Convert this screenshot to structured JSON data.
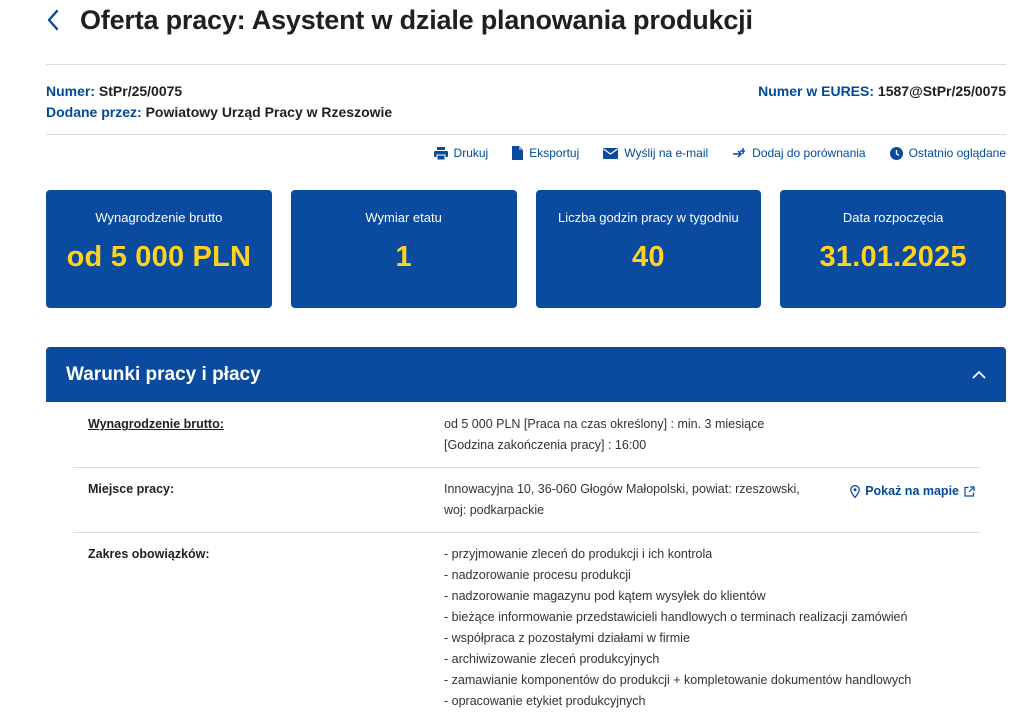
{
  "header": {
    "title": "Oferta pracy: Asystent w dziale planowania produkcji"
  },
  "meta": {
    "number_label": "Numer:",
    "number_value": "StPr/25/0075",
    "added_label": "Dodane przez:",
    "added_value": "Powiatowy Urząd Pracy w Rzeszowie",
    "eures_label": "Numer w EURES:",
    "eures_value": "1587@StPr/25/0075"
  },
  "actions": [
    {
      "label": "Drukuj",
      "icon": "printer-icon"
    },
    {
      "label": "Eksportuj",
      "icon": "document-icon"
    },
    {
      "label": "Wyślij na e-mail",
      "icon": "envelope-icon"
    },
    {
      "label": "Dodaj do porównania",
      "icon": "compare-icon"
    },
    {
      "label": "Ostatnio oglądane",
      "icon": "clock-icon"
    }
  ],
  "cards": [
    {
      "label": "Wynagrodzenie brutto",
      "value": "od 5 000 PLN"
    },
    {
      "label": "Wymiar etatu",
      "value": "1"
    },
    {
      "label": "Liczba godzin pracy w tygodniu",
      "value": "40"
    },
    {
      "label": "Data rozpoczęcia",
      "value": "31.01.2025"
    }
  ],
  "section": {
    "title": "Warunki pracy i płacy",
    "rows": {
      "salary": {
        "label": "Wynagrodzenie brutto:",
        "lines": [
          "od 5 000 PLN [Praca na czas określony] : min. 3 miesiące",
          "[Godzina zakończenia pracy] : 16:00"
        ]
      },
      "place": {
        "label": "Miejsce pracy:",
        "lines": [
          "Innowacyjna 10, 36-060 Głogów Małopolski, powiat: rzeszowski,",
          "woj: podkarpackie"
        ],
        "map_link": "Pokaż na mapie"
      },
      "duties": {
        "label": "Zakres obowiązków:",
        "items": [
          "- przyjmowanie zleceń do produkcji i ich kontrola",
          "- nadzorowanie procesu produkcji",
          "- nadzorowanie magazynu pod kątem wysyłek do klientów",
          "- bieżące informowanie przedstawicieli handlowych o terminach realizacji zamówień",
          "- współpraca z pozostałymi działami w firmie",
          "- archiwizowanie zleceń produkcyjnych",
          "- zamawianie komponentów do produkcji + kompletowanie dokumentów handlowych",
          "- opracowanie etykiet produkcyjnych"
        ]
      }
    }
  },
  "colors": {
    "brand_blue": "#0a4a9f",
    "link_blue": "#004a99",
    "highlight_yellow": "#ffd21f"
  }
}
